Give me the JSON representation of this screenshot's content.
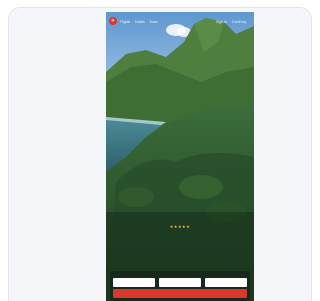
{
  "site": {
    "logo_glyph": "✈",
    "brand_color": "#d8392b"
  },
  "nav": {
    "items": [
      "Flights",
      "Hotels",
      "Tours"
    ],
    "right_items": [
      "Sign in",
      "Currency"
    ]
  },
  "hero": {
    "rating_stars": "★★★★★",
    "title": "",
    "subtitle": ""
  },
  "search": {
    "header": "",
    "link": "",
    "fields": [
      {
        "label": "",
        "value": ""
      },
      {
        "label": "",
        "value": ""
      },
      {
        "label": "",
        "value": ""
      }
    ],
    "button_label": ""
  },
  "colors": {
    "sky": "#6fa6d6",
    "sea": "#3f7f8c",
    "forest": "#2f5e34",
    "mountain": "#4c7a3c"
  }
}
